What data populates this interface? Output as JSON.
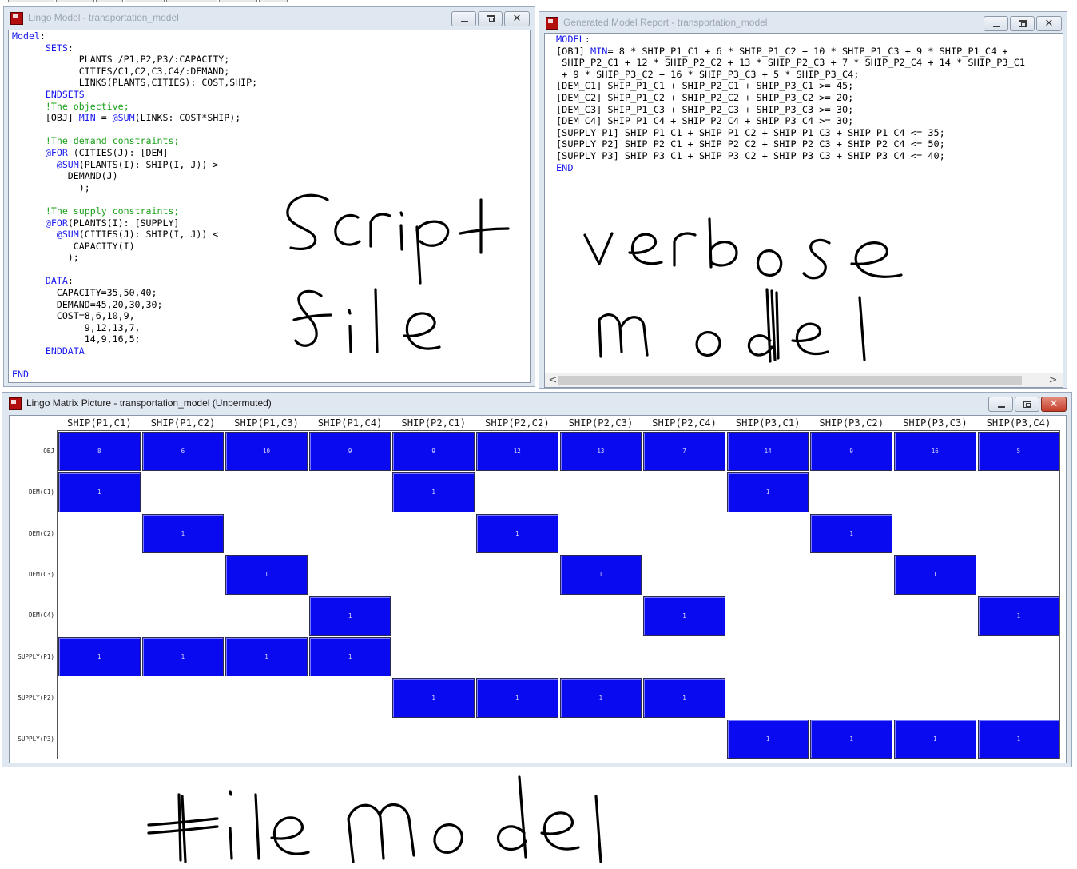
{
  "script_window": {
    "title": "Lingo Model - transportation_model",
    "code": [
      [
        [
          "kw",
          "Model"
        ],
        [
          "t",
          ":"
        ]
      ],
      [
        [
          "t",
          "      "
        ],
        [
          "kw",
          "SETS"
        ],
        [
          "t",
          ":"
        ]
      ],
      [
        [
          "t",
          "            PLANTS /P1,P2,P3/:CAPACITY;"
        ]
      ],
      [
        [
          "t",
          "            CITIES/C1,C2,C3,C4/:DEMAND;"
        ]
      ],
      [
        [
          "t",
          "            LINKS(PLANTS,CITIES): COST,SHIP;"
        ]
      ],
      [
        [
          "t",
          "      "
        ],
        [
          "kw",
          "ENDSETS"
        ]
      ],
      [
        [
          "t",
          "      "
        ],
        [
          "cm",
          "!The objective;"
        ]
      ],
      [
        [
          "t",
          "      [OBJ] "
        ],
        [
          "kw",
          "MIN"
        ],
        [
          "t",
          " = "
        ],
        [
          "kw",
          "@SUM"
        ],
        [
          "t",
          "(LINKS: COST*SHIP);"
        ]
      ],
      [
        [
          "t",
          ""
        ]
      ],
      [
        [
          "t",
          "      "
        ],
        [
          "cm",
          "!The demand constraints;"
        ]
      ],
      [
        [
          "t",
          "      "
        ],
        [
          "kw",
          "@FOR"
        ],
        [
          "t",
          " (CITIES(J): [DEM]"
        ]
      ],
      [
        [
          "t",
          "        "
        ],
        [
          "kw",
          "@SUM"
        ],
        [
          "t",
          "(PLANTS(I): SHIP(I, J)) >"
        ]
      ],
      [
        [
          "t",
          "          DEMAND(J)"
        ]
      ],
      [
        [
          "t",
          "            );"
        ]
      ],
      [
        [
          "t",
          ""
        ]
      ],
      [
        [
          "t",
          "      "
        ],
        [
          "cm",
          "!The supply constraints;"
        ]
      ],
      [
        [
          "t",
          "      "
        ],
        [
          "kw",
          "@FOR"
        ],
        [
          "t",
          "(PLANTS(I): [SUPPLY]"
        ]
      ],
      [
        [
          "t",
          "        "
        ],
        [
          "kw",
          "@SUM"
        ],
        [
          "t",
          "(CITIES(J): SHIP(I, J)) <"
        ]
      ],
      [
        [
          "t",
          "           CAPACITY(I)"
        ]
      ],
      [
        [
          "t",
          "          );"
        ]
      ],
      [
        [
          "t",
          ""
        ]
      ],
      [
        [
          "t",
          "      "
        ],
        [
          "kw",
          "DATA"
        ],
        [
          "t",
          ":"
        ]
      ],
      [
        [
          "t",
          "        CAPACITY=35,50,40;"
        ]
      ],
      [
        [
          "t",
          "        DEMAND=45,20,30,30;"
        ]
      ],
      [
        [
          "t",
          "        COST=8,6,10,9,"
        ]
      ],
      [
        [
          "t",
          "             9,12,13,7,"
        ]
      ],
      [
        [
          "t",
          "             14,9,16,5;"
        ]
      ],
      [
        [
          "t",
          "      "
        ],
        [
          "kw",
          "ENDDATA"
        ]
      ],
      [
        [
          "t",
          ""
        ]
      ],
      [
        [
          "kw",
          "END"
        ]
      ]
    ]
  },
  "report_window": {
    "title": "Generated Model Report - transportation_model",
    "code": [
      [
        [
          "kw",
          "MODEL"
        ],
        [
          "t",
          ":"
        ]
      ],
      [
        [
          "t",
          "[OBJ] "
        ],
        [
          "kw",
          "MIN"
        ],
        [
          "t",
          "= 8 * SHIP_P1_C1 + 6 * SHIP_P1_C2 + 10 * SHIP_P1_C3 + 9 * SHIP_P1_C4 +"
        ]
      ],
      [
        [
          "t",
          " SHIP_P2_C1 + 12 * SHIP_P2_C2 + 13 * SHIP_P2_C3 + 7 * SHIP_P2_C4 + 14 * SHIP_P3_C1"
        ]
      ],
      [
        [
          "t",
          " + 9 * SHIP_P3_C2 + 16 * SHIP_P3_C3 + 5 * SHIP_P3_C4;"
        ]
      ],
      [
        [
          "t",
          "[DEM_C1] SHIP_P1_C1 + SHIP_P2_C1 + SHIP_P3_C1 >= 45;"
        ]
      ],
      [
        [
          "t",
          "[DEM_C2] SHIP_P1_C2 + SHIP_P2_C2 + SHIP_P3_C2 >= 20;"
        ]
      ],
      [
        [
          "t",
          "[DEM_C3] SHIP_P1_C3 + SHIP_P2_C3 + SHIP_P3_C3 >= 30;"
        ]
      ],
      [
        [
          "t",
          "[DEM_C4] SHIP_P1_C4 + SHIP_P2_C4 + SHIP_P3_C4 >= 30;"
        ]
      ],
      [
        [
          "t",
          "[SUPPLY_P1] SHIP_P1_C1 + SHIP_P1_C2 + SHIP_P1_C3 + SHIP_P1_C4 <= 35;"
        ]
      ],
      [
        [
          "t",
          "[SUPPLY_P2] SHIP_P2_C1 + SHIP_P2_C2 + SHIP_P2_C3 + SHIP_P2_C4 <= 50;"
        ]
      ],
      [
        [
          "t",
          "[SUPPLY_P3] SHIP_P3_C1 + SHIP_P3_C2 + SHIP_P3_C3 + SHIP_P3_C4 <= 40;"
        ]
      ],
      [
        [
          "kw",
          "END"
        ]
      ]
    ],
    "scroll_left": "<",
    "scroll_right": ">"
  },
  "matrix_window": {
    "title": "Lingo Matrix Picture - transportation_model (Unpermuted)",
    "columns": [
      "SHIP(P1,C1)",
      "SHIP(P1,C2)",
      "SHIP(P1,C3)",
      "SHIP(P1,C4)",
      "SHIP(P2,C1)",
      "SHIP(P2,C2)",
      "SHIP(P2,C3)",
      "SHIP(P2,C4)",
      "SHIP(P3,C1)",
      "SHIP(P3,C2)",
      "SHIP(P3,C3)",
      "SHIP(P3,C4)"
    ],
    "rows": [
      {
        "label": "OBJ",
        "cells": [
          "8",
          "6",
          "10",
          "9",
          "9",
          "12",
          "13",
          "7",
          "14",
          "9",
          "16",
          "5"
        ]
      },
      {
        "label": "DEM(C1)",
        "cells": [
          "1",
          "",
          "",
          "",
          "1",
          "",
          "",
          "",
          "1",
          "",
          "",
          ""
        ]
      },
      {
        "label": "DEM(C2)",
        "cells": [
          "",
          "1",
          "",
          "",
          "",
          "1",
          "",
          "",
          "",
          "1",
          "",
          ""
        ]
      },
      {
        "label": "DEM(C3)",
        "cells": [
          "",
          "",
          "1",
          "",
          "",
          "",
          "1",
          "",
          "",
          "",
          "1",
          ""
        ]
      },
      {
        "label": "DEM(C4)",
        "cells": [
          "",
          "",
          "",
          "1",
          "",
          "",
          "",
          "1",
          "",
          "",
          "",
          "1"
        ]
      },
      {
        "label": "SUPPLY(P1)",
        "cells": [
          "1",
          "1",
          "1",
          "1",
          "",
          "",
          "",
          "",
          "",
          "",
          "",
          ""
        ]
      },
      {
        "label": "SUPPLY(P2)",
        "cells": [
          "",
          "",
          "",
          "",
          "1",
          "1",
          "1",
          "1",
          "",
          "",
          "",
          ""
        ]
      },
      {
        "label": "SUPPLY(P3)",
        "cells": [
          "",
          "",
          "",
          "",
          "",
          "",
          "",
          "",
          "1",
          "1",
          "1",
          "1"
        ]
      }
    ],
    "cell_color": "#0a0af0"
  },
  "annotations": {
    "script_file": "Script file",
    "verbose_model": "verbose model",
    "tile_model": "tile model"
  },
  "colors": {
    "keyword": "#1a1aee",
    "comment": "#1aa01a",
    "window_frame": "#dfe7f1"
  }
}
